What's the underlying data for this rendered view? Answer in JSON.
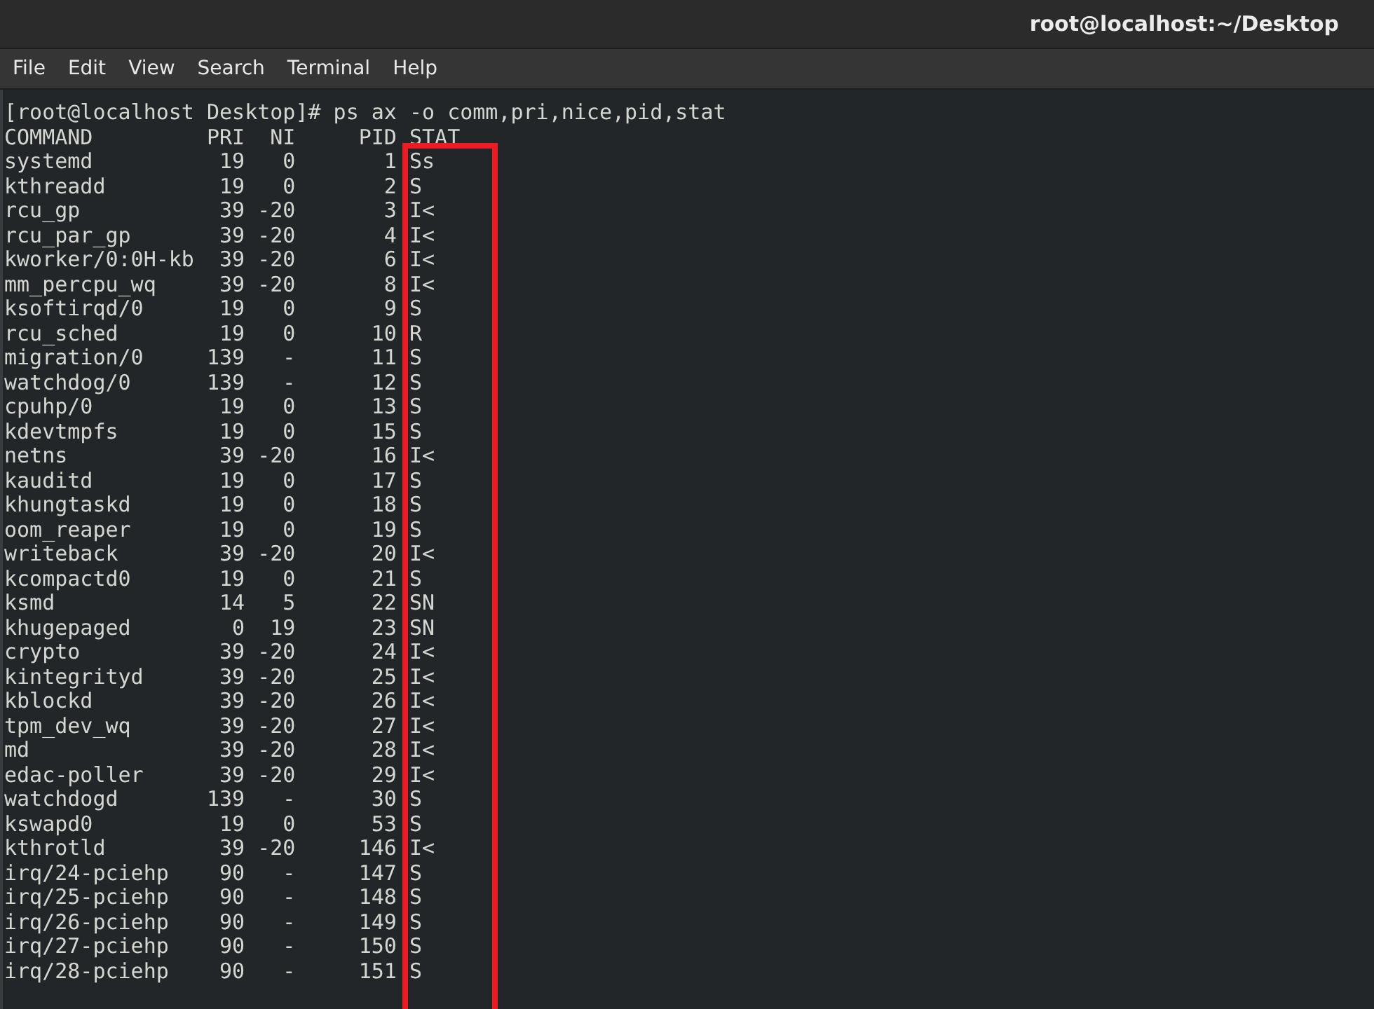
{
  "window": {
    "title": "root@localhost:~/Desktop"
  },
  "menu": [
    "File",
    "Edit",
    "View",
    "Search",
    "Terminal",
    "Help"
  ],
  "terminal": {
    "prompt": "[root@localhost Desktop]# ps ax -o comm,pri,nice,pid,stat",
    "header": {
      "comm": "COMMAND",
      "pri": "PRI",
      "ni": "NI",
      "pid": "PID",
      "stat": "STAT"
    },
    "rows": [
      {
        "comm": "systemd",
        "pri": "19",
        "ni": "0",
        "pid": "1",
        "stat": "Ss"
      },
      {
        "comm": "kthreadd",
        "pri": "19",
        "ni": "0",
        "pid": "2",
        "stat": "S"
      },
      {
        "comm": "rcu_gp",
        "pri": "39",
        "ni": "-20",
        "pid": "3",
        "stat": "I<"
      },
      {
        "comm": "rcu_par_gp",
        "pri": "39",
        "ni": "-20",
        "pid": "4",
        "stat": "I<"
      },
      {
        "comm": "kworker/0:0H-kb",
        "pri": "39",
        "ni": "-20",
        "pid": "6",
        "stat": "I<"
      },
      {
        "comm": "mm_percpu_wq",
        "pri": "39",
        "ni": "-20",
        "pid": "8",
        "stat": "I<"
      },
      {
        "comm": "ksoftirqd/0",
        "pri": "19",
        "ni": "0",
        "pid": "9",
        "stat": "S"
      },
      {
        "comm": "rcu_sched",
        "pri": "19",
        "ni": "0",
        "pid": "10",
        "stat": "R"
      },
      {
        "comm": "migration/0",
        "pri": "139",
        "ni": "-",
        "pid": "11",
        "stat": "S"
      },
      {
        "comm": "watchdog/0",
        "pri": "139",
        "ni": "-",
        "pid": "12",
        "stat": "S"
      },
      {
        "comm": "cpuhp/0",
        "pri": "19",
        "ni": "0",
        "pid": "13",
        "stat": "S"
      },
      {
        "comm": "kdevtmpfs",
        "pri": "19",
        "ni": "0",
        "pid": "15",
        "stat": "S"
      },
      {
        "comm": "netns",
        "pri": "39",
        "ni": "-20",
        "pid": "16",
        "stat": "I<"
      },
      {
        "comm": "kauditd",
        "pri": "19",
        "ni": "0",
        "pid": "17",
        "stat": "S"
      },
      {
        "comm": "khungtaskd",
        "pri": "19",
        "ni": "0",
        "pid": "18",
        "stat": "S"
      },
      {
        "comm": "oom_reaper",
        "pri": "19",
        "ni": "0",
        "pid": "19",
        "stat": "S"
      },
      {
        "comm": "writeback",
        "pri": "39",
        "ni": "-20",
        "pid": "20",
        "stat": "I<"
      },
      {
        "comm": "kcompactd0",
        "pri": "19",
        "ni": "0",
        "pid": "21",
        "stat": "S"
      },
      {
        "comm": "ksmd",
        "pri": "14",
        "ni": "5",
        "pid": "22",
        "stat": "SN"
      },
      {
        "comm": "khugepaged",
        "pri": "0",
        "ni": "19",
        "pid": "23",
        "stat": "SN"
      },
      {
        "comm": "crypto",
        "pri": "39",
        "ni": "-20",
        "pid": "24",
        "stat": "I<"
      },
      {
        "comm": "kintegrityd",
        "pri": "39",
        "ni": "-20",
        "pid": "25",
        "stat": "I<"
      },
      {
        "comm": "kblockd",
        "pri": "39",
        "ni": "-20",
        "pid": "26",
        "stat": "I<"
      },
      {
        "comm": "tpm_dev_wq",
        "pri": "39",
        "ni": "-20",
        "pid": "27",
        "stat": "I<"
      },
      {
        "comm": "md",
        "pri": "39",
        "ni": "-20",
        "pid": "28",
        "stat": "I<"
      },
      {
        "comm": "edac-poller",
        "pri": "39",
        "ni": "-20",
        "pid": "29",
        "stat": "I<"
      },
      {
        "comm": "watchdogd",
        "pri": "139",
        "ni": "-",
        "pid": "30",
        "stat": "S"
      },
      {
        "comm": "kswapd0",
        "pri": "19",
        "ni": "0",
        "pid": "53",
        "stat": "S"
      },
      {
        "comm": "kthrotld",
        "pri": "39",
        "ni": "-20",
        "pid": "146",
        "stat": "I<"
      },
      {
        "comm": "irq/24-pciehp",
        "pri": "90",
        "ni": "-",
        "pid": "147",
        "stat": "S"
      },
      {
        "comm": "irq/25-pciehp",
        "pri": "90",
        "ni": "-",
        "pid": "148",
        "stat": "S"
      },
      {
        "comm": "irq/26-pciehp",
        "pri": "90",
        "ni": "-",
        "pid": "149",
        "stat": "S"
      },
      {
        "comm": "irq/27-pciehp",
        "pri": "90",
        "ni": "-",
        "pid": "150",
        "stat": "S"
      },
      {
        "comm": "irq/28-pciehp",
        "pri": "90",
        "ni": "-",
        "pid": "151",
        "stat": "S"
      }
    ]
  }
}
